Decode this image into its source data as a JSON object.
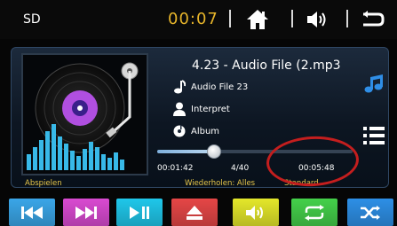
{
  "top_bar": {
    "source": "SD",
    "clock": "00:07",
    "buttons": [
      "home-icon",
      "volume-icon",
      "back-icon"
    ]
  },
  "track": {
    "title": "4.23 - Audio File (2.mp3",
    "file": "Audio File 23",
    "artist": "Interpret",
    "album": "Album",
    "elapsed": "00:01:42",
    "index": "4/40",
    "duration": "00:05:48",
    "progress": 0.29
  },
  "footer": {
    "status": "Abspielen",
    "repeat": "Wiederholen: Alles",
    "eq": "Standard"
  },
  "controls": [
    {
      "icon": "previous-icon",
      "color": "#3aa6e8"
    },
    {
      "icon": "next-icon",
      "color": "#d94ad1"
    },
    {
      "icon": "play-pause-icon",
      "color": "#1fc7ea"
    },
    {
      "icon": "eject-icon",
      "color": "#e54646"
    },
    {
      "icon": "volume-icon",
      "color": "#e4e72a"
    },
    {
      "icon": "repeat-icon",
      "color": "#44d04a"
    },
    {
      "icon": "shuffle-icon",
      "color": "#2d8fe6"
    }
  ],
  "accent": "#e6b42a",
  "annotation_color": "#c41e1e"
}
